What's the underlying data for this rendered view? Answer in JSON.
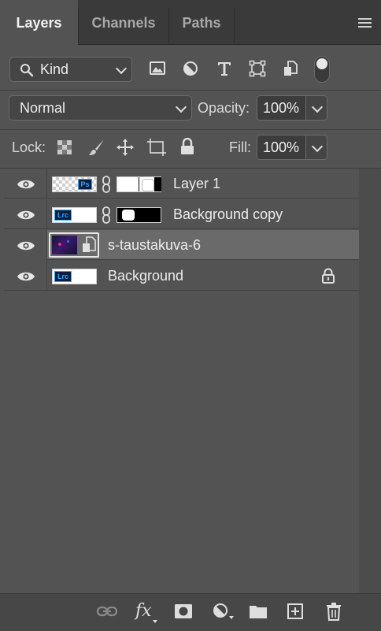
{
  "tabs": [
    {
      "label": "Layers",
      "active": true
    },
    {
      "label": "Channels",
      "active": false
    },
    {
      "label": "Paths",
      "active": false
    }
  ],
  "filter": {
    "kind_label": "Kind",
    "icons": [
      "image-filter-icon",
      "adjustment-filter-icon",
      "type-filter-icon",
      "shape-filter-icon",
      "smart-object-filter-icon",
      "filter-toggle-switch"
    ]
  },
  "blend": {
    "mode": "Normal",
    "opacity_label": "Opacity:",
    "opacity_value": "100%"
  },
  "lock": {
    "label": "Lock:",
    "icons": [
      "lock-transparent-pixels-icon",
      "lock-image-pixels-icon",
      "lock-position-icon",
      "lock-artboard-icon",
      "lock-all-icon"
    ],
    "fill_label": "Fill:",
    "fill_value": "100%"
  },
  "layers": [
    {
      "name": "Layer 1",
      "visible": true,
      "selected": false,
      "thumb": "ps",
      "mask": "white-mask",
      "linked": true
    },
    {
      "name": "Background copy",
      "visible": true,
      "selected": false,
      "thumb": "lrc",
      "mask": "black-mask",
      "linked": true
    },
    {
      "name": "s-taustakuva-6",
      "visible": true,
      "selected": true,
      "thumb": "photo",
      "smart_object": true
    },
    {
      "name": "Background",
      "visible": true,
      "selected": false,
      "thumb": "lrc",
      "locked": true
    }
  ],
  "thumb_text": {
    "ps": "Ps",
    "lrc": "Lrc"
  },
  "bottom_icons": [
    "link-layers-icon",
    "fx-icon",
    "add-mask-icon",
    "adjustment-layer-icon",
    "new-group-icon",
    "new-layer-icon",
    "delete-layer-icon"
  ],
  "bottom_fx_text": "fx",
  "colors": {
    "panel": "#535353",
    "tabbar": "#3a3a3a",
    "selected_row": "#6a6a6a",
    "app_badge": "#0a1e3c",
    "app_text": "#31a8ff"
  }
}
